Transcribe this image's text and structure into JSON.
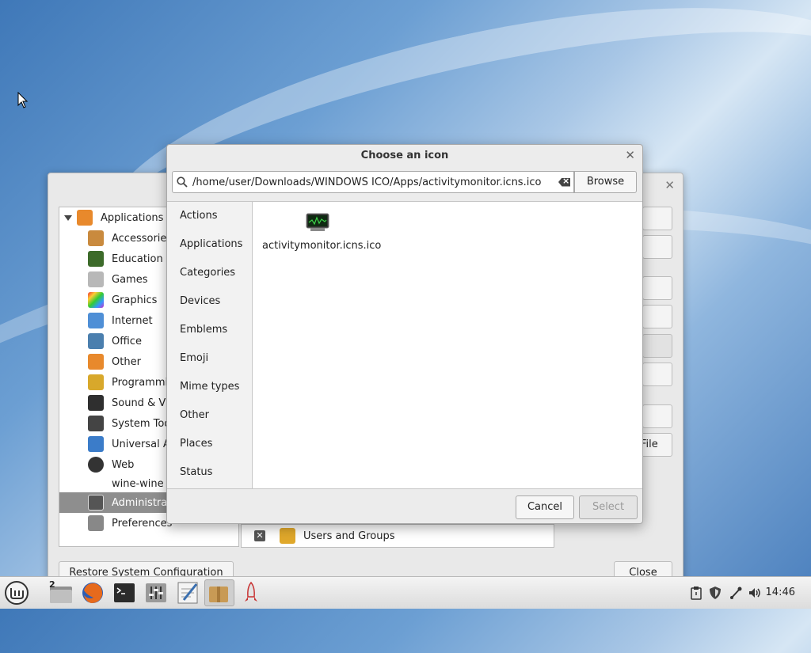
{
  "dialog": {
    "title": "Choose an icon",
    "path_value": "/home/user/Downloads/WINDOWS ICO/Apps/activitymonitor.icns.ico",
    "browse_label": "Browse",
    "categories": [
      "Actions",
      "Applications",
      "Categories",
      "Devices",
      "Emblems",
      "Emoji",
      "Mime types",
      "Other",
      "Places",
      "Status"
    ],
    "icon_item_label": "activitymonitor.icns.ico",
    "cancel_label": "Cancel",
    "select_label": "Select"
  },
  "menu_editor": {
    "tree": [
      {
        "label": "Applications",
        "icon": "applications-icon",
        "color": "#e8892c"
      },
      {
        "label": "Accessories",
        "icon": "accessories-icon",
        "color": "#c98a3e"
      },
      {
        "label": "Education",
        "icon": "education-icon",
        "color": "#3d6b2a"
      },
      {
        "label": "Games",
        "icon": "games-icon",
        "color": "#9c9c9c"
      },
      {
        "label": "Graphics",
        "icon": "graphics-icon",
        "color": "#c0409f"
      },
      {
        "label": "Internet",
        "icon": "internet-icon",
        "color": "#4f8fd6"
      },
      {
        "label": "Office",
        "icon": "office-icon",
        "color": "#4b7fae"
      },
      {
        "label": "Other",
        "icon": "other-icon",
        "color": "#e8892c"
      },
      {
        "label": "Programmi",
        "icon": "programming-icon",
        "color": "#d8a82b"
      },
      {
        "label": "Sound & Vic",
        "icon": "sound-video-icon",
        "color": "#2f2f2f"
      },
      {
        "label": "System Too",
        "icon": "system-tools-icon",
        "color": "#444444"
      },
      {
        "label": "Universal A",
        "icon": "universal-access-icon",
        "color": "#3b7cc9"
      },
      {
        "label": "Web",
        "icon": "web-icon",
        "color": "#333333"
      },
      {
        "label": "wine-wine",
        "icon": "",
        "color": ""
      },
      {
        "label": "Administrat",
        "icon": "administration-icon",
        "color": "#555555"
      },
      {
        "label": "Preferences",
        "icon": "preferences-icon",
        "color": "#777777"
      }
    ],
    "file_btn_label": "File",
    "users_groups_label": "Users and Groups",
    "restore_label": "Restore System Configuration",
    "close_label": "Close"
  },
  "taskbar": {
    "workspace_badge": "2",
    "clock": "14:46"
  },
  "colors": {
    "selection": "#8e8e8e",
    "desktop_blue": "#4a7fbd"
  }
}
